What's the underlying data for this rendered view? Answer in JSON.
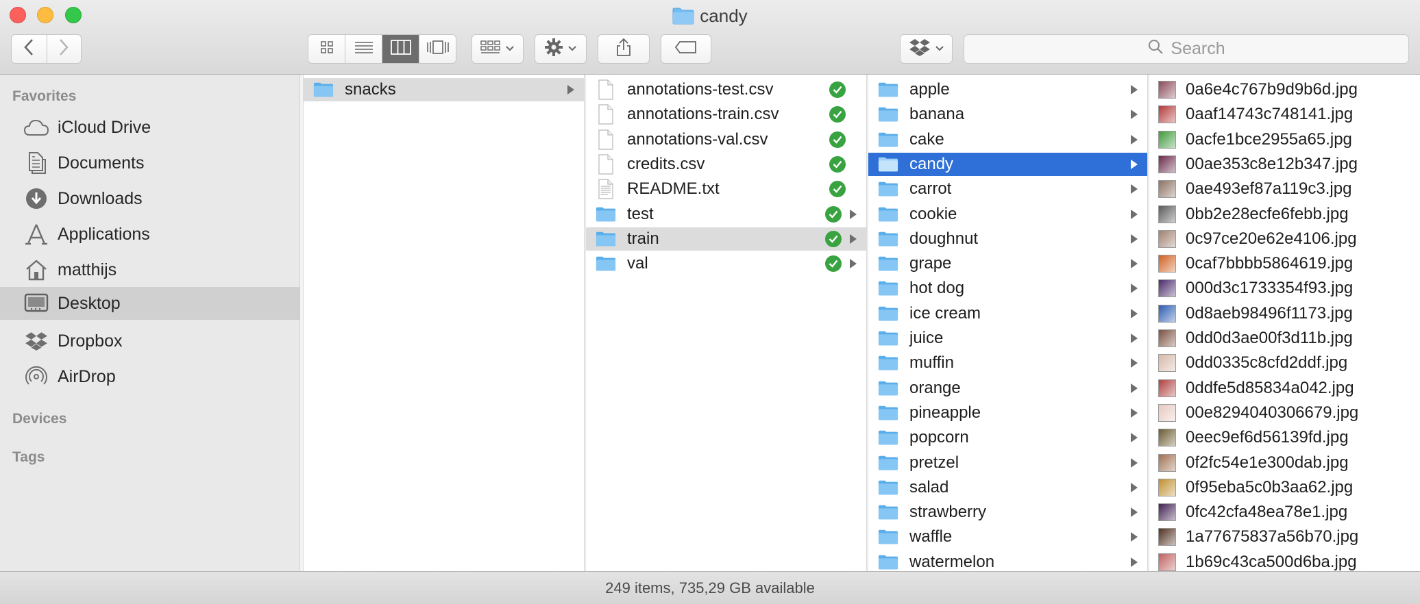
{
  "window": {
    "title": "candy"
  },
  "toolbar": {
    "search_placeholder": "Search",
    "view_modes": [
      "icon-view",
      "list-view",
      "column-view",
      "cover-flow-view"
    ],
    "active_view": "column-view",
    "icons": {
      "back": "chevron-left-icon",
      "forward": "chevron-right-icon",
      "arrange": "arrange-grid-icon",
      "action": "gear-icon",
      "share": "share-icon",
      "tags": "tag-icon",
      "dropbox": "dropbox-icon",
      "search": "search-icon"
    }
  },
  "sidebar": {
    "favorites_heading": "Favorites",
    "devices_heading": "Devices",
    "tags_heading": "Tags",
    "items": [
      {
        "label": "iCloud Drive",
        "icon": "cloud-icon"
      },
      {
        "label": "Documents",
        "icon": "documents-icon"
      },
      {
        "label": "Downloads",
        "icon": "downloads-icon"
      },
      {
        "label": "Applications",
        "icon": "applications-icon"
      },
      {
        "label": "matthijs",
        "icon": "home-icon"
      },
      {
        "label": "Desktop",
        "icon": "desktop-icon",
        "selected": true
      },
      {
        "label": "Dropbox",
        "icon": "dropbox-icon"
      },
      {
        "label": "AirDrop",
        "icon": "airdrop-icon"
      }
    ]
  },
  "columns": {
    "col1": [
      {
        "label": "snacks",
        "type": "folder",
        "selected": "gray",
        "has_children": true
      }
    ],
    "col2": [
      {
        "label": "annotations-test.csv",
        "type": "file",
        "synced": true
      },
      {
        "label": "annotations-train.csv",
        "type": "file",
        "synced": true
      },
      {
        "label": "annotations-val.csv",
        "type": "file",
        "synced": true
      },
      {
        "label": "credits.csv",
        "type": "file",
        "synced": true
      },
      {
        "label": "README.txt",
        "type": "text",
        "synced": true
      },
      {
        "label": "test",
        "type": "folder",
        "synced": true,
        "has_children": true
      },
      {
        "label": "train",
        "type": "folder",
        "synced": true,
        "has_children": true,
        "selected": "gray"
      },
      {
        "label": "val",
        "type": "folder",
        "synced": true,
        "has_children": true
      }
    ],
    "col3": [
      {
        "label": "apple"
      },
      {
        "label": "banana"
      },
      {
        "label": "cake"
      },
      {
        "label": "candy",
        "selected": "blue"
      },
      {
        "label": "carrot"
      },
      {
        "label": "cookie"
      },
      {
        "label": "doughnut"
      },
      {
        "label": "grape"
      },
      {
        "label": "hot dog"
      },
      {
        "label": "ice cream"
      },
      {
        "label": "juice"
      },
      {
        "label": "muffin"
      },
      {
        "label": "orange"
      },
      {
        "label": "pineapple"
      },
      {
        "label": "popcorn"
      },
      {
        "label": "pretzel"
      },
      {
        "label": "salad"
      },
      {
        "label": "strawberry"
      },
      {
        "label": "waffle"
      },
      {
        "label": "watermelon"
      }
    ],
    "col4": [
      {
        "label": "0a6e4c767b9d9b6d.jpg",
        "color": "#8a4a5a"
      },
      {
        "label": "0aaf14743c748141.jpg",
        "color": "#b33a3a"
      },
      {
        "label": "0acfe1bce2955a65.jpg",
        "color": "#3f9a3a"
      },
      {
        "label": "00ae353c8e12b347.jpg",
        "color": "#6a2a4a"
      },
      {
        "label": "0ae493ef87a119c3.jpg",
        "color": "#8c7060"
      },
      {
        "label": "0bb2e28ecfe6febb.jpg",
        "color": "#5a5a5a"
      },
      {
        "label": "0c97ce20e62e4106.jpg",
        "color": "#a08070"
      },
      {
        "label": "0caf7bbbb5864619.jpg",
        "color": "#d06020"
      },
      {
        "label": "000d3c1733354f93.jpg",
        "color": "#4a2a6a"
      },
      {
        "label": "0d8aeb98496f1173.jpg",
        "color": "#2a5ab0"
      },
      {
        "label": "0dd0d3ae00f3d11b.jpg",
        "color": "#7a5040"
      },
      {
        "label": "0dd0335c8cfd2ddf.jpg",
        "color": "#d8b8a8"
      },
      {
        "label": "0ddfe5d85834a042.jpg",
        "color": "#b04040"
      },
      {
        "label": "00e8294040306679.jpg",
        "color": "#e8c8c0"
      },
      {
        "label": "0eec9ef6d56139fd.jpg",
        "color": "#6a5a30"
      },
      {
        "label": "0f2fc54e1e300dab.jpg",
        "color": "#a07050"
      },
      {
        "label": "0f95eba5c0b3aa62.jpg",
        "color": "#c09030"
      },
      {
        "label": "0fc42cfa48ea78e1.jpg",
        "color": "#402050"
      },
      {
        "label": "1a77675837a56b70.jpg",
        "color": "#503020"
      },
      {
        "label": "1b69c43ca500d6ba.jpg",
        "color": "#c06060"
      }
    ]
  },
  "status": {
    "text": "249 items, 735,29 GB available"
  },
  "colors": {
    "selection_blue": "#2e6fd8",
    "folder_blue": "#6cb6f0",
    "sync_green": "#3aa341"
  }
}
